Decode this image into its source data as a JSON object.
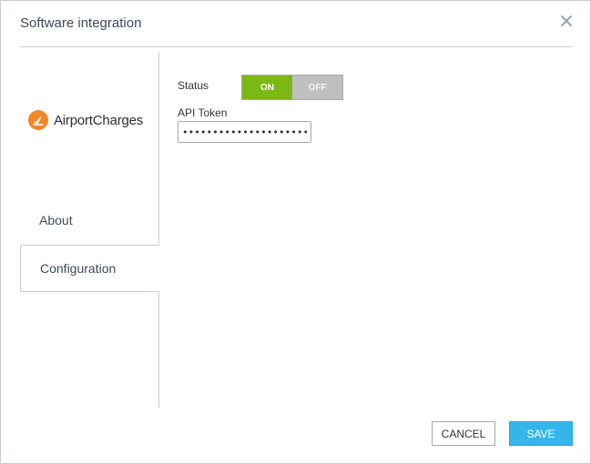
{
  "dialog": {
    "title": "Software integration",
    "close_icon": "close-icon"
  },
  "sidebar": {
    "logo_text": "AirportCharges",
    "logo_color": "#f0882a",
    "items": [
      {
        "label": "About",
        "active": false
      },
      {
        "label": "Configuration",
        "active": true
      }
    ]
  },
  "config": {
    "status_label": "Status",
    "toggle_on": "ON",
    "toggle_off": "OFF",
    "status_value": "ON",
    "token_label": "API Token",
    "token_value": "••••••••••••••••••••••••••••••••••"
  },
  "footer": {
    "cancel_label": "CANCEL",
    "save_label": "SAVE"
  },
  "colors": {
    "toggle_on": "#7cb814",
    "toggle_off": "#bfbfbf",
    "save_button": "#35b6ea",
    "title_text": "#3c4a5c"
  }
}
